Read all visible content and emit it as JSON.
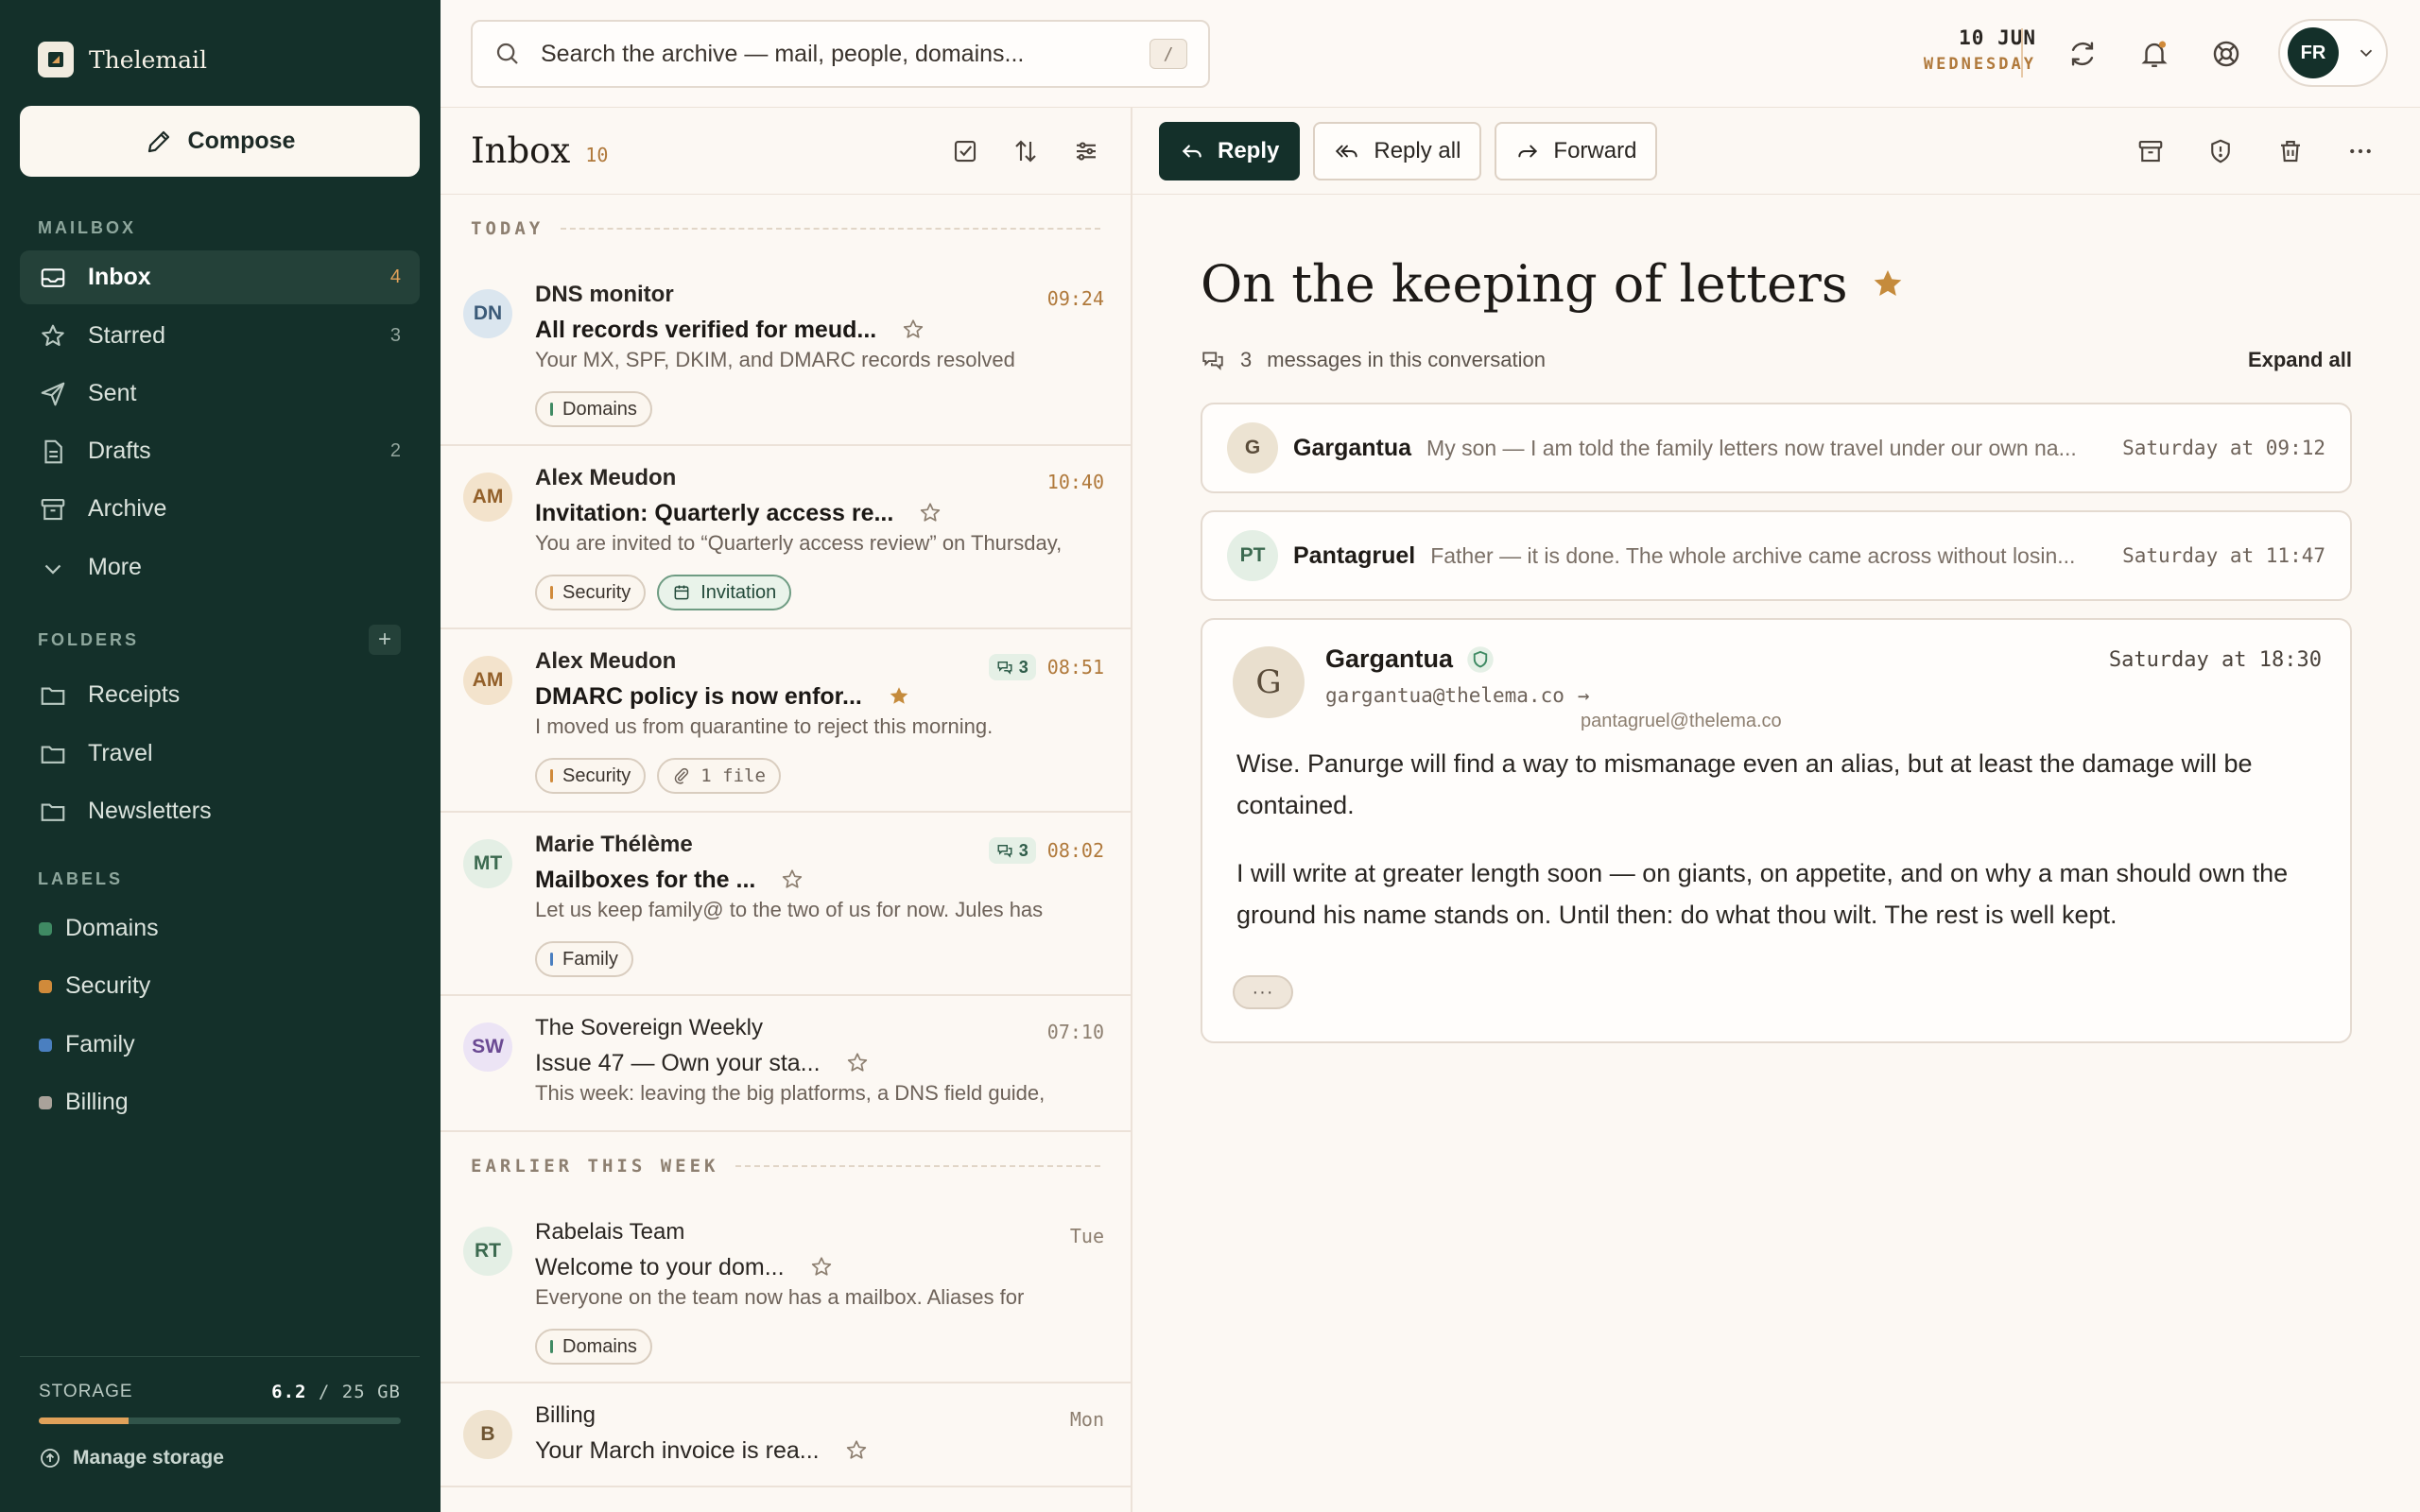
{
  "app": {
    "name": "Thelemail"
  },
  "sidebar": {
    "compose_label": "Compose",
    "mailbox_heading": "MAILBOX",
    "mailbox": [
      {
        "label": "Inbox",
        "count": "4",
        "icon": "inbox-icon",
        "active": true
      },
      {
        "label": "Starred",
        "count": "3",
        "icon": "star-icon"
      },
      {
        "label": "Sent",
        "count": "",
        "icon": "send-icon"
      },
      {
        "label": "Drafts",
        "count": "2",
        "icon": "draft-icon"
      },
      {
        "label": "Archive",
        "count": "",
        "icon": "archive-icon"
      },
      {
        "label": "More",
        "count": "",
        "icon": "chevron-down-icon"
      }
    ],
    "folders_heading": "FOLDERS",
    "folders": [
      "Receipts",
      "Travel",
      "Newsletters"
    ],
    "labels_heading": "LABELS",
    "labels": [
      {
        "name": "Domains",
        "color": "#3f8a63"
      },
      {
        "name": "Security",
        "color": "#d08a3a"
      },
      {
        "name": "Family",
        "color": "#4a7fc0"
      },
      {
        "name": "Billing",
        "color": "#a9a29a"
      }
    ],
    "storage": {
      "label": "STORAGE",
      "used": "6.2",
      "total": "/ 25 GB",
      "fraction": 0.248,
      "manage_label": "Manage storage"
    }
  },
  "topbar": {
    "search_placeholder": "Search the archive — mail, people, domains...",
    "search_shortcut": "/",
    "date_day": "10 JUN",
    "date_weekday": "WEDNESDAY",
    "user_initials": "FR"
  },
  "list": {
    "title": "Inbox",
    "count": "10",
    "sections": [
      {
        "heading": "TODAY",
        "items": [
          {
            "initials": "DN",
            "avatar_bg": "#dbe6ef",
            "avatar_fg": "#3b5a78",
            "from": "DNS monitor",
            "time": "09:24",
            "subject": "All records verified for meud...",
            "preview": "Your MX, SPF, DKIM, and DMARC records resolved",
            "starred": false,
            "unread": true,
            "thread": "",
            "tags": [
              {
                "label": "Domains",
                "color": "#3f8a63",
                "kind": "label"
              }
            ]
          },
          {
            "initials": "AM",
            "avatar_bg": "#f3e3cc",
            "avatar_fg": "#93602a",
            "from": "Alex Meudon",
            "time": "10:40",
            "subject": "Invitation: Quarterly access re...",
            "preview": "You are invited to “Quarterly access review” on Thursday,",
            "starred": false,
            "unread": true,
            "thread": "",
            "tags": [
              {
                "label": "Security",
                "color": "#d08a3a",
                "kind": "label"
              },
              {
                "label": "Invitation",
                "color": "",
                "kind": "invite"
              }
            ]
          },
          {
            "initials": "AM",
            "avatar_bg": "#f3e3cc",
            "avatar_fg": "#93602a",
            "from": "Alex Meudon",
            "time": "08:51",
            "subject": "DMARC policy is now enfor...",
            "preview": "I moved us from quarantine to reject this morning.",
            "starred": true,
            "unread": true,
            "thread": "3",
            "tags": [
              {
                "label": "Security",
                "color": "#d08a3a",
                "kind": "label"
              },
              {
                "label": "1 file",
                "color": "",
                "kind": "file"
              }
            ]
          },
          {
            "initials": "MT",
            "avatar_bg": "#e4efe5",
            "avatar_fg": "#3c6a50",
            "from": "Marie Thélème",
            "time": "08:02",
            "subject": "Mailboxes for the ...",
            "preview": "Let us keep family@ to the two of us for now. Jules has",
            "starred": false,
            "unread": true,
            "thread": "3",
            "tags": [
              {
                "label": "Family",
                "color": "#4a7fc0",
                "kind": "label"
              }
            ]
          },
          {
            "initials": "SW",
            "avatar_bg": "#ece4f5",
            "avatar_fg": "#6b4a93",
            "from": "The Sovereign Weekly",
            "time": "07:10",
            "subject": "Issue 47 — Own your sta...",
            "preview": "This week: leaving the big platforms, a DNS field guide,",
            "starred": false,
            "unread": false,
            "thread": "",
            "tags": []
          }
        ]
      },
      {
        "heading": "EARLIER THIS WEEK",
        "items": [
          {
            "initials": "RT",
            "avatar_bg": "#e4efe5",
            "avatar_fg": "#3c6a50",
            "from": "Rabelais Team",
            "time": "Tue",
            "subject": "Welcome to your dom...",
            "preview": "Everyone on the team now has a mailbox. Aliases for",
            "starred": false,
            "unread": false,
            "thread": "",
            "tags": [
              {
                "label": "Domains",
                "color": "#3f8a63",
                "kind": "label"
              }
            ]
          },
          {
            "initials": "B",
            "avatar_bg": "#efe3cf",
            "avatar_fg": "#6e5431",
            "from": "Billing",
            "time": "Mon",
            "subject": "Your March invoice is rea...",
            "preview": "",
            "starred": false,
            "unread": false,
            "thread": "",
            "tags": []
          }
        ]
      }
    ]
  },
  "reader": {
    "reply_label": "Reply",
    "reply_all_label": "Reply all",
    "forward_label": "Forward",
    "subject": "On the keeping of letters",
    "message_count": "3",
    "messages_text": "messages in this conversation",
    "expand_all_label": "Expand all",
    "collapsed": [
      {
        "initials": "G",
        "avatar_bg": "#ece3d2",
        "avatar_fg": "#5a4c3a",
        "name": "Gargantua",
        "snippet": "My son — I am told the family letters now travel under our own na...",
        "when": "Saturday at 09:12"
      },
      {
        "initials": "PT",
        "avatar_bg": "#e4efe5",
        "avatar_fg": "#3c6a50",
        "name": "Pantagruel",
        "snippet": "Father — it is done. The whole archive came across without losin...",
        "when": "Saturday at 11:47"
      }
    ],
    "open_message": {
      "initials": "G",
      "name": "Gargantua",
      "from_address": "gargantua@thelema.co",
      "arrow": "→",
      "to_address": "pantagruel@thelema.co",
      "when": "Saturday at 18:30",
      "paragraphs": [
        "Wise. Panurge will find a way to mismanage even an alias, but at least the damage will be contained.",
        "I will write at greater length soon — on giants, on appetite, and on why a man should own the ground his name stands on. Until then: do what thou wilt. The rest is well kept."
      ],
      "more_label": "···"
    }
  },
  "colors": {
    "sidebar_bg": "#14302a",
    "accent": "#b0793b",
    "star": "#c58b3c"
  }
}
